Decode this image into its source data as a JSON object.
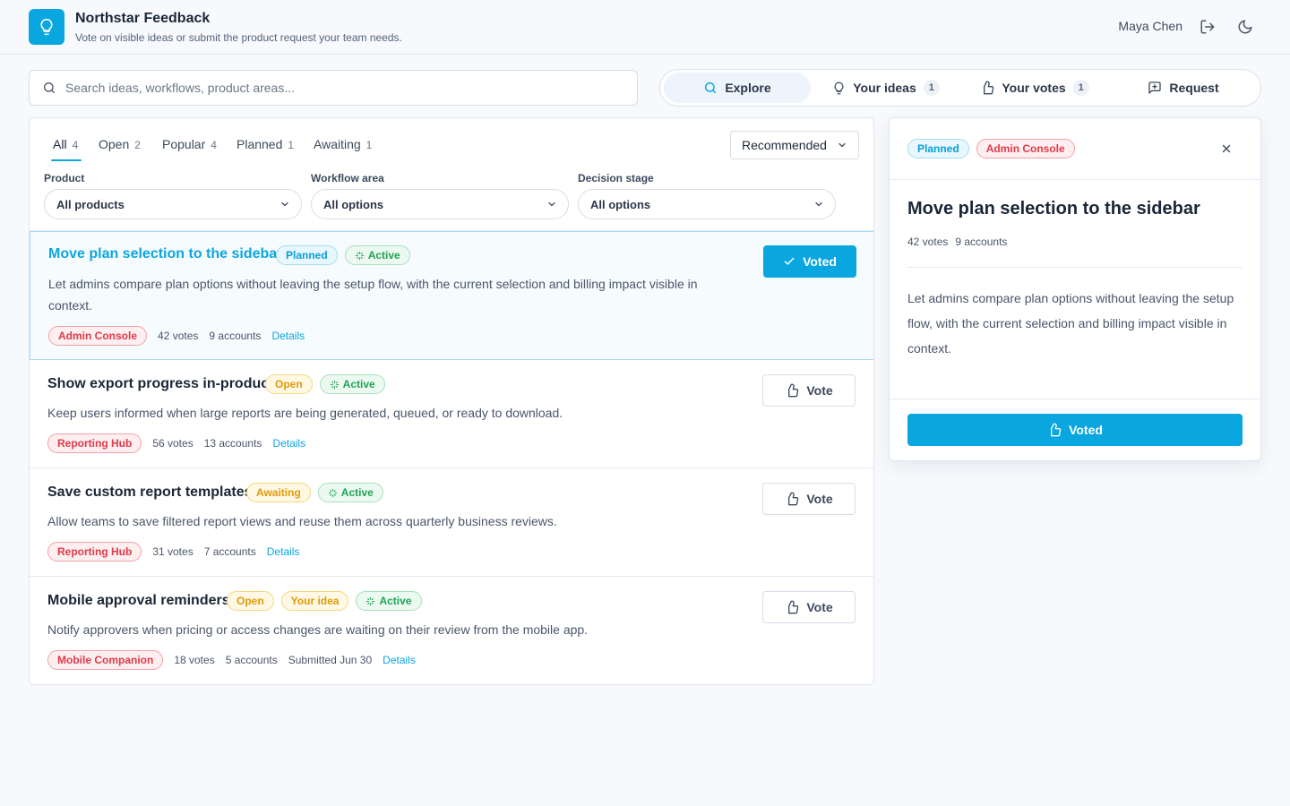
{
  "app": {
    "title": "Northstar Feedback",
    "subtitle": "Vote on visible ideas or submit the product request your team needs.",
    "user": "Maya Chen",
    "accent": "#0aa6e0"
  },
  "search": {
    "placeholder": "Search ideas, workflows, product areas..."
  },
  "nav": {
    "explore": "Explore",
    "your_ideas": "Your ideas",
    "your_ideas_count": "1",
    "your_votes": "Your votes",
    "your_votes_count": "1",
    "request": "Request"
  },
  "tabs": {
    "all": "All",
    "all_count": "4",
    "open": "Open",
    "open_count": "2",
    "popular": "Popular",
    "popular_count": "4",
    "planned": "Planned",
    "planned_count": "1",
    "awaiting": "Awaiting",
    "awaiting_count": "1"
  },
  "sort": {
    "value": "Recommended"
  },
  "filters": {
    "product_label": "Product",
    "product_value": "All products",
    "workflow_label": "Workflow area",
    "workflow_value": "All options",
    "stage_label": "Decision stage",
    "stage_value": "All options"
  },
  "ideas": [
    {
      "title": "Move plan selection to the sidebar",
      "status": "Planned",
      "activity": "Active",
      "description": "Let admins compare plan options without leaving the setup flow, with the current selection and billing impact visible in context.",
      "area": "Admin Console",
      "votes": "42 votes",
      "accounts": "9 accounts",
      "details": "Details",
      "vote_label": "Voted"
    },
    {
      "title": "Show export progress in-product",
      "status": "Open",
      "activity": "Active",
      "description": "Keep users informed when large reports are being generated, queued, or ready to download.",
      "area": "Reporting Hub",
      "votes": "56 votes",
      "accounts": "13 accounts",
      "details": "Details",
      "vote_label": "Vote"
    },
    {
      "title": "Save custom report templates",
      "status": "Awaiting",
      "activity": "Active",
      "description": "Allow teams to save filtered report views and reuse them across quarterly business reviews.",
      "area": "Reporting Hub",
      "votes": "31 votes",
      "accounts": "7 accounts",
      "details": "Details",
      "vote_label": "Vote"
    },
    {
      "title": "Mobile approval reminders",
      "status": "Open",
      "owner_badge": "Your idea",
      "activity": "Active",
      "description": "Notify approvers when pricing or access changes are waiting on their review from the mobile app.",
      "area": "Mobile Companion",
      "votes": "18 votes",
      "accounts": "5 accounts",
      "submitted": "Submitted Jun 30",
      "details": "Details",
      "vote_label": "Vote"
    }
  ],
  "detail": {
    "status": "Planned",
    "area": "Admin Console",
    "title": "Move plan selection to the sidebar",
    "votes": "42 votes",
    "accounts": "9 accounts",
    "description": "Let admins compare plan options without leaving the setup flow, with the current selection and billing impact visible in context.",
    "vote_label": "Voted"
  }
}
